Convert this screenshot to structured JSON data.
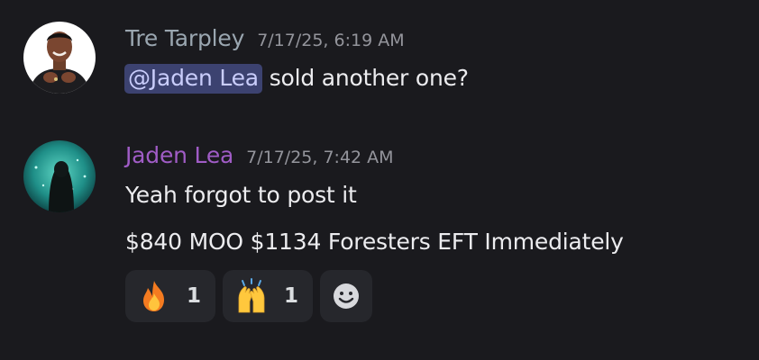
{
  "messages": [
    {
      "author": "Tre Tarpley",
      "timestamp": "7/17/25, 6:19 AM",
      "mention": "@Jaden Lea",
      "text": "sold another one?"
    },
    {
      "author": "Jaden Lea",
      "timestamp": "7/17/25, 7:42 AM",
      "lines": [
        "Yeah forgot to post it",
        "$840 MOO $1134 Foresters EFT Immediately"
      ],
      "reactions": [
        {
          "icon": "fire-emoji",
          "count": "1"
        },
        {
          "icon": "raising-hands-emoji",
          "count": "1"
        }
      ],
      "add_reaction_icon": "smiley-add-reaction-icon"
    }
  ],
  "colors": {
    "background": "#1a1a1e",
    "username_1": "#9aa6b0",
    "username_2": "#a05cc6",
    "mention_bg": "#3c4270",
    "mention_text": "#c9cdfb",
    "timestamp": "#94959c",
    "reaction_bg": "#26272c"
  }
}
